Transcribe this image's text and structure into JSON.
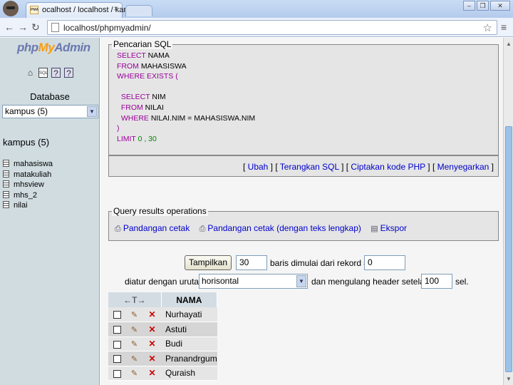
{
  "browser": {
    "tab_title": "ocalhost / localhost / kampus",
    "tab_favicon": "PMA",
    "close_glyph": "×",
    "url": "localhost/phpmyadmin/",
    "window_controls": [
      "–",
      "❐",
      "✕"
    ]
  },
  "sidebar": {
    "logo_php": "php",
    "logo_my": "My",
    "logo_admin": "Admin",
    "icons": [
      "home-icon",
      "sql-icon",
      "docs-icon",
      "help-icon"
    ],
    "database_label": "Database",
    "database_select": "kampus (5)",
    "db_heading": "kampus (5)",
    "tables": [
      "mahasiswa",
      "matakuliah",
      "mhsview",
      "mhs_2",
      "nilai"
    ]
  },
  "sql_box": {
    "legend": "Pencarian SQL",
    "lines": [
      {
        "kw": "SELECT",
        "rest": " NAMA"
      },
      {
        "kw": "FROM",
        "rest": " MAHASISWA"
      },
      {
        "kw": "WHERE EXISTS",
        "rest": " ("
      },
      {
        "kw": "",
        "rest": ""
      },
      {
        "kw": "  SELECT",
        "rest": " NIM"
      },
      {
        "kw": "  FROM",
        "rest": " NILAI"
      },
      {
        "kw": "  WHERE",
        "rest": " NILAI.NIM = MAHASISWA.NIM"
      },
      {
        "kw": "",
        "rest": ")"
      },
      {
        "kw": "LIMIT",
        "rest": " 0 , 30"
      }
    ]
  },
  "sql_links": {
    "open": "[ ",
    "edit": "Ubah",
    "sep": " ] [ ",
    "explain": "Terangkan SQL",
    "php": "Ciptakan kode PHP",
    "refresh": "Menyegarkan",
    "close": " ]"
  },
  "operations": {
    "legend": "Query results operations",
    "print_view": "Pandangan cetak",
    "print_view_full": "Pandangan cetak (dengan teks lengkap)",
    "export": "Ekspor"
  },
  "nav_form": {
    "show_button": "Tampilkan",
    "rows_value": "30",
    "rows_text": "baris dimulai dari rekord #",
    "start_value": "0",
    "mode_text": "diatur dengan urutan",
    "mode_value": "horisontal",
    "repeat_text": "dan mengulang header setelah",
    "repeat_value": "100",
    "cells_text": "sel."
  },
  "results": {
    "arrows_header": "←T→",
    "column_header": "NAMA",
    "rows": [
      "Nurhayati",
      "Astuti",
      "Budi",
      "Pranandrgum",
      "Quraish"
    ]
  }
}
